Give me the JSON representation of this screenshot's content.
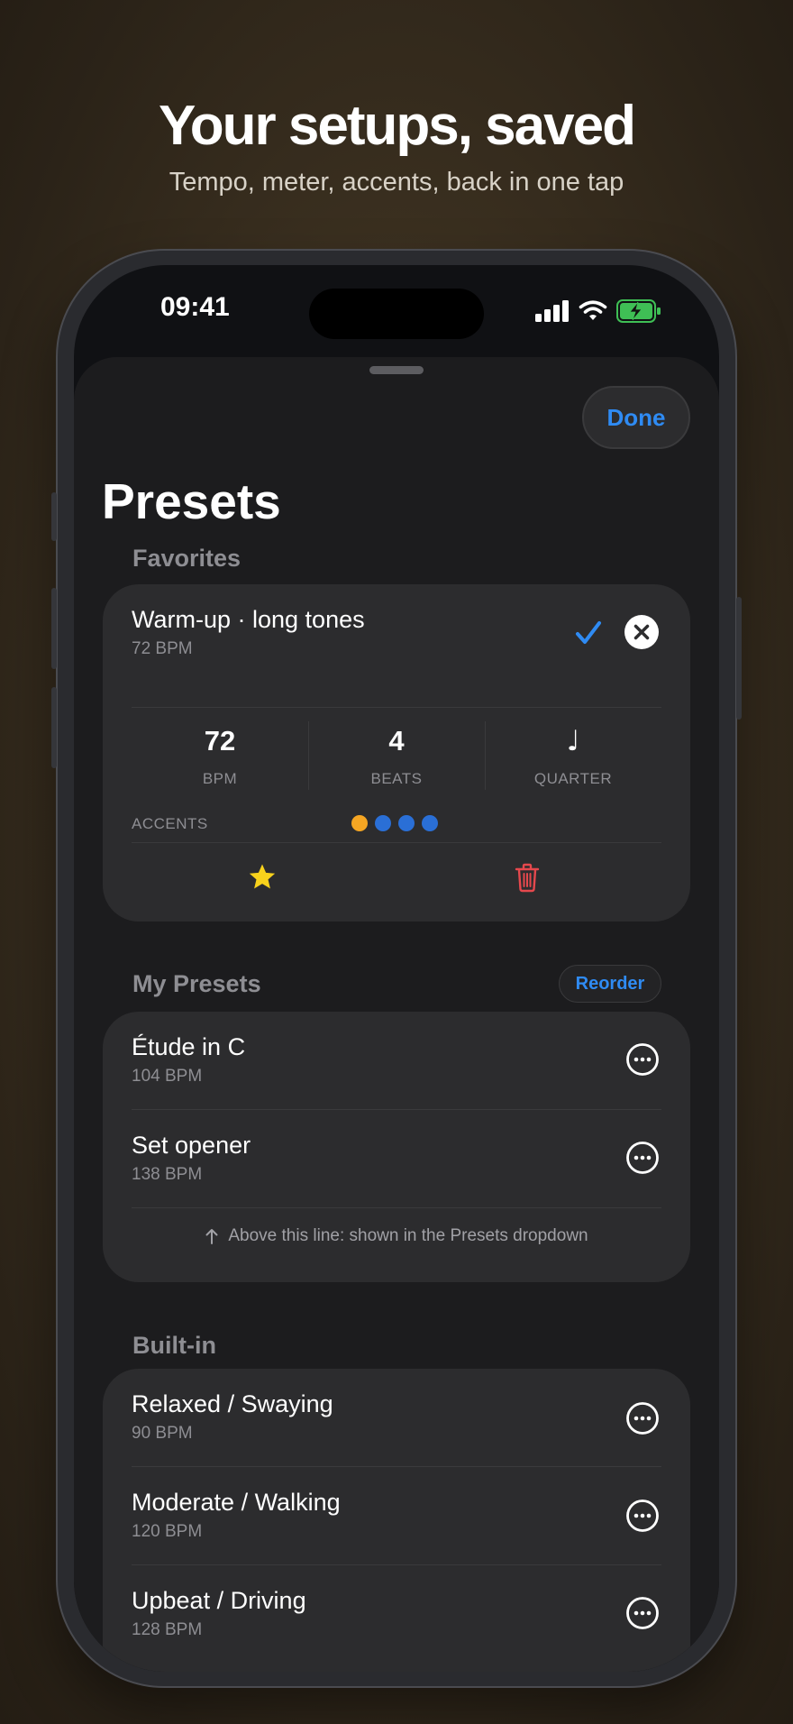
{
  "marketing": {
    "headline": "Your setups, saved",
    "subheadline": "Tempo, meter, accents, back in one tap"
  },
  "status_bar": {
    "time": "09:41"
  },
  "sheet": {
    "done_label": "Done",
    "title": "Presets"
  },
  "favorites": {
    "section_label": "Favorites",
    "preset": {
      "name": "Warm-up · long tones",
      "bpm_text": "72 BPM",
      "bpm_value": "72",
      "bpm_label": "BPM",
      "beats_value": "4",
      "beats_label": "BEATS",
      "note_value": "♩",
      "note_label": "QUARTER",
      "accents_label": "ACCENTS",
      "accents": [
        "accent",
        "normal",
        "normal",
        "normal"
      ]
    }
  },
  "my_presets": {
    "section_label": "My Presets",
    "reorder_label": "Reorder",
    "items": [
      {
        "name": "Étude in C",
        "bpm": "104 BPM"
      },
      {
        "name": "Set opener",
        "bpm": "138 BPM"
      }
    ],
    "footer_note": "Above this line: shown in the Presets dropdown"
  },
  "built_in": {
    "section_label": "Built-in",
    "items": [
      {
        "name": "Relaxed / Swaying",
        "bpm": "90 BPM"
      },
      {
        "name": "Moderate / Walking",
        "bpm": "120 BPM"
      },
      {
        "name": "Upbeat / Driving",
        "bpm": "128 BPM"
      }
    ]
  },
  "colors": {
    "accent_blue": "#2f8bf3",
    "accent_orange": "#f5a623",
    "beat_blue": "#2a6fd6",
    "star_yellow": "#f8d21c",
    "delete_red": "#e5484d"
  },
  "icons": [
    "cellular-icon",
    "wifi-icon",
    "battery-charging-icon",
    "checkmark-icon",
    "close-circle-icon",
    "star-icon",
    "trash-icon",
    "more-icon",
    "arrow-up-icon"
  ]
}
